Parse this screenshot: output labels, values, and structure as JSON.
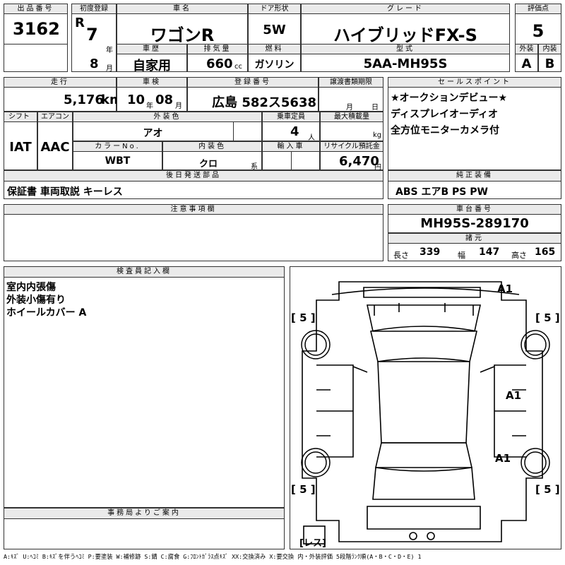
{
  "headers": {
    "lot_no": "出品番号",
    "first_reg": "初度登録",
    "car_name": "車名",
    "door": "ドア形状",
    "grade": "グレード",
    "score": "評価点",
    "history": "車歴",
    "displacement": "排気量",
    "fuel": "燃料",
    "model": "型式",
    "exterior": "外装",
    "interior": "内装",
    "mileage": "走行",
    "inspection": "車検",
    "reg_no": "登録番号",
    "transfer_doc": "譲渡書類期限",
    "sales_point": "セールスポイント",
    "shift": "シフト",
    "aircon": "エアコン",
    "ext_color": "外装色",
    "capacity": "乗車定員",
    "max_load": "最大積載量",
    "color_no": "カラーNo.",
    "int_color": "内装色",
    "import": "輸入車",
    "recycle": "リサイクル預託金",
    "later_parts": "後日発送部品",
    "genuine_equip": "純正装備",
    "caution": "注意事項欄",
    "chassis_no": "車台番号",
    "specs": "諸元",
    "inspector": "検査員記入欄",
    "office": "事務局よりご案内"
  },
  "vehicle": {
    "lot_no": "3162",
    "era": "R",
    "year": "7",
    "year_unit": "年",
    "month": "8",
    "month_unit": "月",
    "car_name": "ワゴンR",
    "door": "5W",
    "grade": "ハイブリッドFX-S",
    "score": "5",
    "history": "自家用",
    "displacement": "660",
    "displacement_unit": "cc",
    "fuel": "ガソリン",
    "model": "5AA-MH95S",
    "exterior": "A",
    "interior": "B",
    "mileage": "5,176",
    "mileage_unit": "km",
    "insp_year": "10",
    "insp_year_unit": "年",
    "insp_month": "08",
    "insp_month_unit": "月",
    "reg_no": "広島 582ス5638",
    "transfer_month": "月",
    "transfer_day": "日",
    "shift": "IAT",
    "aircon": "AAC",
    "ext_color": "アオ",
    "capacity": "4",
    "capacity_unit": "人",
    "max_load_unit": "kg",
    "color_no": "WBT",
    "int_color": "クロ",
    "int_color_unit": "系",
    "recycle": "6,470",
    "recycle_unit": "円",
    "later_parts": "保証書 車両取説 キーレス",
    "genuine_equip": "ABS エアB PS PW",
    "chassis_no": "MH95S-289170"
  },
  "sales_points": [
    "★オークションデビュー★",
    "ディスプレイオーディオ",
    "全方位モニターカメラ付"
  ],
  "specs": {
    "length_label": "長さ",
    "length": "339",
    "width_label": "幅",
    "width": "147",
    "height_label": "高さ",
    "height": "165"
  },
  "inspector_notes": [
    "室内内張傷",
    "外装小傷有り",
    "ホイールカバー A"
  ],
  "diagram": {
    "tire_fl": "[ 5 ]",
    "tire_fr": "[ 5 ]",
    "tire_rl": "[ 5 ]",
    "tire_rr": "[ 5 ]",
    "mark_roof_front": "A1",
    "mark_right_door": "A1",
    "mark_right_rear": "A1",
    "spare": "[レス]"
  },
  "legend": "A:ｷｽﾞ U:ﾍｺﾐ B:ｷｽﾞを伴うﾍｺﾐ P:要塗装 W:補修跡 S:錆 C:腐食 G:ﾌﾛﾝﾄｶﾞﾗｽ点ｷｽﾞ XX:交換済み X:要交換 内・外装評価 5段階ﾗﾝｸ順(A・B・C・D・E) 1"
}
